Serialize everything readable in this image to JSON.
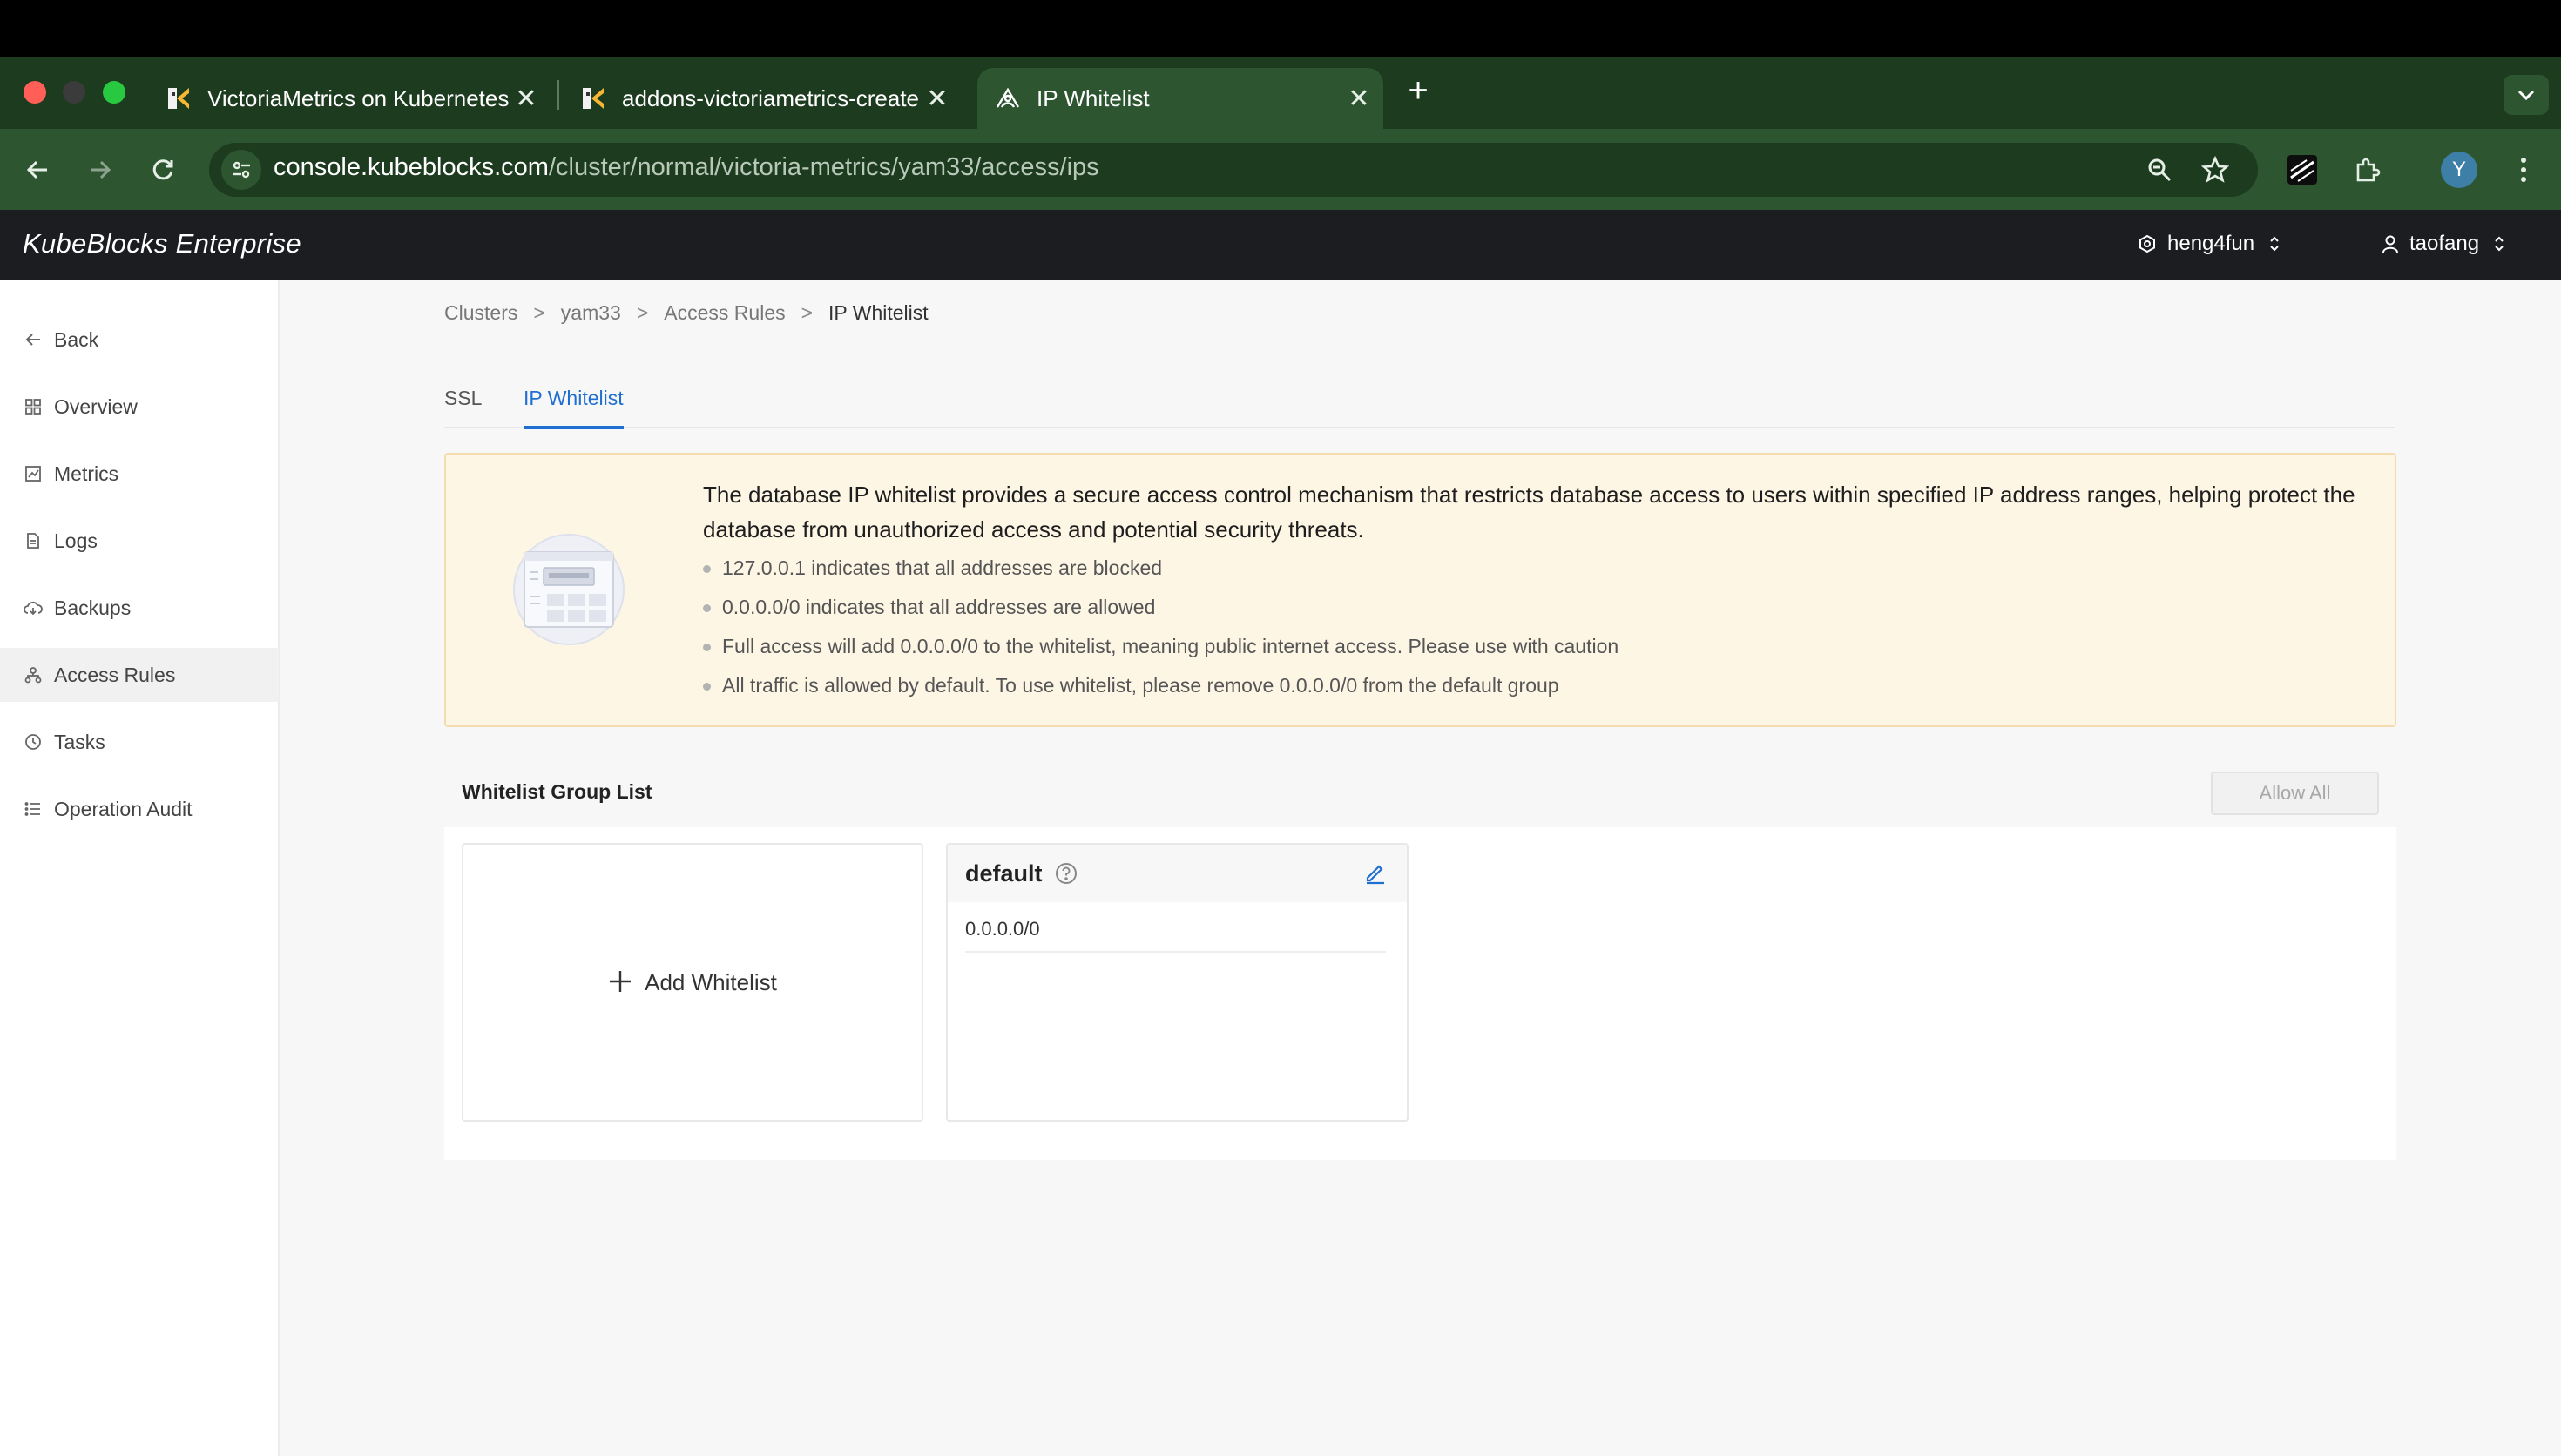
{
  "browser": {
    "tabs": [
      {
        "title": "VictoriaMetrics on Kubernetes",
        "active": false
      },
      {
        "title": "addons-victoriametrics-create",
        "active": false
      },
      {
        "title": "IP Whitelist",
        "active": true
      }
    ],
    "url_host": "console.kubeblocks.com",
    "url_path": "/cluster/normal/victoria-metrics/yam33/access/ips",
    "profile_initial": "Y",
    "colors": {
      "frame": "#1d3b1f",
      "toolbar": "#2c5530"
    }
  },
  "header": {
    "brand": "KubeBlocks Enterprise",
    "org": "heng4fun",
    "user": "taofang"
  },
  "sidebar": {
    "items": [
      {
        "label": "Back",
        "icon": "arrow-left-icon"
      },
      {
        "label": "Overview",
        "icon": "grid-icon"
      },
      {
        "label": "Metrics",
        "icon": "chart-icon"
      },
      {
        "label": "Logs",
        "icon": "document-icon"
      },
      {
        "label": "Backups",
        "icon": "cloud-icon"
      },
      {
        "label": "Access Rules",
        "icon": "network-icon",
        "active": true
      },
      {
        "label": "Tasks",
        "icon": "clock-icon"
      },
      {
        "label": "Operation Audit",
        "icon": "list-icon"
      }
    ]
  },
  "breadcrumb": [
    "Clusters",
    "yam33",
    "Access Rules",
    "IP Whitelist"
  ],
  "tabs": {
    "ssl": "SSL",
    "ip_whitelist": "IP Whitelist",
    "active": "IP Whitelist",
    "accent": "#1f6fd1"
  },
  "notice": {
    "main": "The database IP whitelist provides a secure access control mechanism that restricts database access to users within specified IP address ranges, helping protect the database from unauthorized access and potential security threats.",
    "bullets": [
      "127.0.0.1 indicates that all addresses are blocked",
      "0.0.0.0/0 indicates that all addresses are allowed",
      "Full access will add 0.0.0.0/0 to the whitelist, meaning public internet access. Please use with caution",
      "All traffic is allowed by default. To use whitelist, please remove 0.0.0.0/0 from the default group"
    ]
  },
  "whitelist": {
    "title": "Whitelist Group List",
    "allow_all_label": "Allow All",
    "add_label": "Add Whitelist",
    "groups": [
      {
        "name": "default",
        "ips": [
          "0.0.0.0/0"
        ]
      }
    ]
  }
}
